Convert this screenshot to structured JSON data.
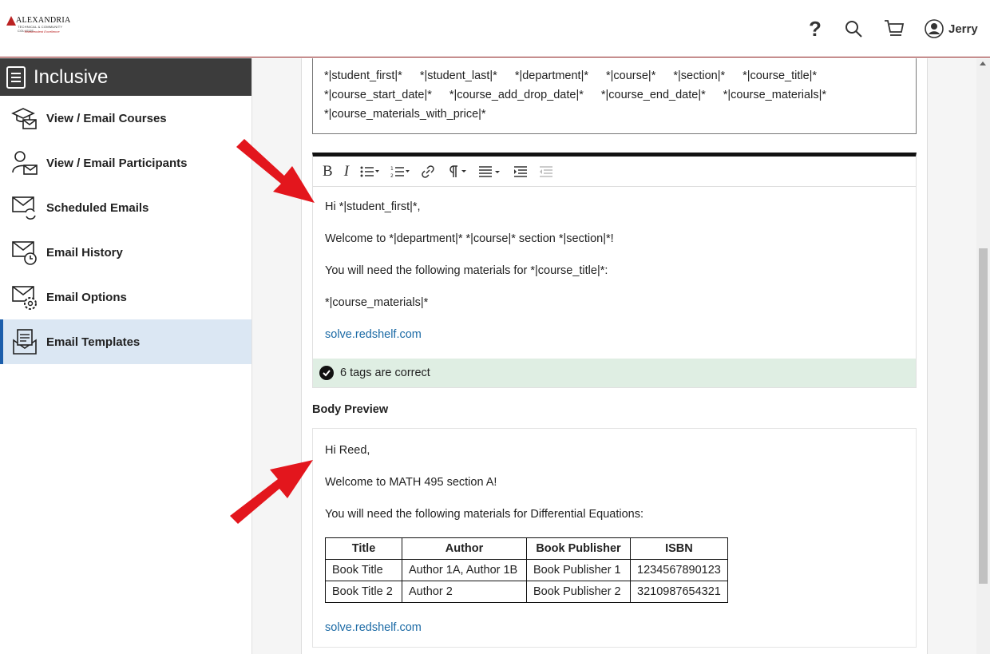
{
  "header": {
    "logo": {
      "name": "ALEXANDRIA",
      "line1": "TECHNICAL & COMMUNITY COLLEGE",
      "line2": "Transcendent Excellence"
    },
    "user_name": "Jerry"
  },
  "sidebar": {
    "title": "Inclusive",
    "items": [
      {
        "label": "View / Email Courses",
        "icon": "graduation-cap-mail-icon"
      },
      {
        "label": "View / Email Participants",
        "icon": "person-mail-icon"
      },
      {
        "label": "Scheduled Emails",
        "icon": "mail-refresh-icon"
      },
      {
        "label": "Email History",
        "icon": "mail-clock-icon"
      },
      {
        "label": "Email Options",
        "icon": "mail-gear-icon"
      },
      {
        "label": "Email Templates",
        "icon": "mail-template-icon"
      }
    ]
  },
  "tags": [
    "*|student_first|*",
    "*|student_last|*",
    "*|department|*",
    "*|course|*",
    "*|section|*",
    "*|course_title|*",
    "*|course_start_date|*",
    "*|course_add_drop_date|*",
    "*|course_end_date|*",
    "*|course_materials|*",
    "*|course_materials_with_price|*"
  ],
  "editor": {
    "lines": [
      "Hi *|student_first|*,",
      "Welcome to *|department|* *|course|* section *|section|*!",
      "You will need the following materials for *|course_title|*:",
      "*|course_materials|*"
    ],
    "link": "solve.redshelf.com",
    "status": "6 tags are correct"
  },
  "preview": {
    "label": "Body Preview",
    "lines": [
      "Hi Reed,",
      "Welcome to MATH 495 section A!",
      "You will need the following materials for Differential Equations:"
    ],
    "table": {
      "headers": [
        "Title",
        "Author",
        "Book Publisher",
        "ISBN"
      ],
      "rows": [
        [
          "Book Title",
          "Author 1A, Author 1B",
          "Book Publisher 1",
          "1234567890123"
        ],
        [
          "Book Title 2",
          "Author 2",
          "Book Publisher 2",
          "3210987654321"
        ]
      ]
    },
    "link": "solve.redshelf.com"
  },
  "colors": {
    "accent": "#1b5eab",
    "header_rule": "#8b1a1a",
    "success_bg": "#dfeee3",
    "arrow": "#e3161d"
  }
}
